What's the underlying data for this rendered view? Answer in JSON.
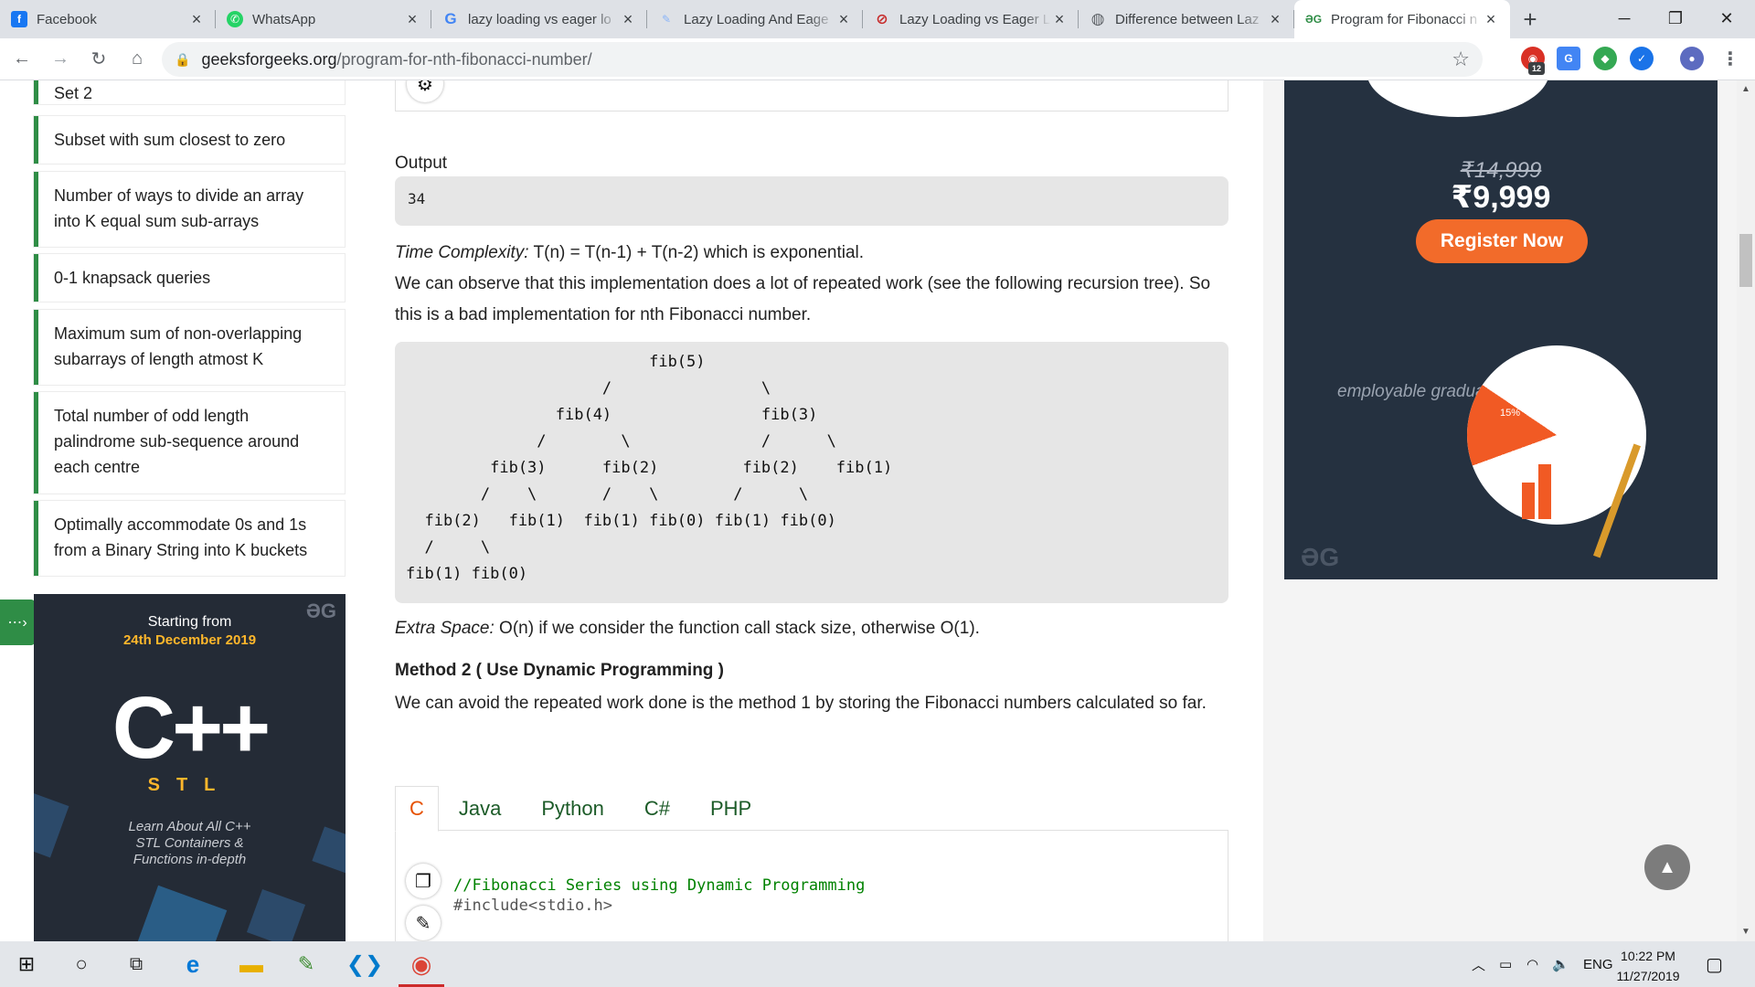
{
  "tabs": [
    {
      "title": "Facebook",
      "icon": "facebook-icon",
      "color": "#1877f2",
      "glyph": "f"
    },
    {
      "title": "WhatsApp",
      "icon": "whatsapp-icon",
      "color": "#25d366",
      "glyph": "✆"
    },
    {
      "title": "lazy loading vs eager lo",
      "icon": "google-icon",
      "color": "#4285f4",
      "glyph": "G"
    },
    {
      "title": "Lazy Loading And Eage",
      "icon": "page-icon",
      "color": "#9aa0a6",
      "glyph": "✎"
    },
    {
      "title": "Lazy Loading vs Eager L",
      "icon": "site-icon",
      "color": "#c62828",
      "glyph": "⊘"
    },
    {
      "title": "Difference between Laz",
      "icon": "globe-icon",
      "color": "#5f6368",
      "glyph": "◍"
    },
    {
      "title": "Program for Fibonacci n",
      "icon": "gfg-icon",
      "color": "#2f8d46",
      "glyph": "ƏG"
    }
  ],
  "toolbar": {
    "url_host": "geeksforgeeks.org",
    "url_path": "/program-for-nth-fibonacci-number/",
    "ext_badge": "12"
  },
  "sidebar": {
    "items": [
      "Set 2",
      "Subset with sum closest to zero",
      "Number of ways to divide an array into K equal sum sub-arrays",
      "0-1 knapsack queries",
      "Maximum sum of non-overlapping subarrays of length atmost K",
      "Total number of odd length palindrome sub-sequence around each centre",
      "Optimally accommodate 0s and 1s from a Binary String into K buckets"
    ],
    "ad": {
      "starting": "Starting from",
      "date": "24th December 2019",
      "logo": "C++",
      "stl": "STL",
      "learn": "Learn About All C++ STL Containers & Functions in-depth",
      "brand": "ƏG"
    }
  },
  "article": {
    "output_heading": "Output",
    "output_value": "34",
    "time_label": "Time Complexity:",
    "time_text": " T(n) = T(n-1) + T(n-2) which is exponential.",
    "observe_text": "We can observe that this implementation does a lot of repeated work (see the following recursion tree). So this is a bad implementation for nth Fibonacci number.",
    "tree": "                          fib(5)\n                     /                \\\n                fib(4)                fib(3)\n              /        \\              /      \\\n         fib(3)      fib(2)         fib(2)    fib(1)\n        /    \\       /    \\        /      \\\n  fib(2)   fib(1)  fib(1) fib(0) fib(1) fib(0)\n  /     \\\nfib(1) fib(0)",
    "space_label": "Extra Space:",
    "space_text": " O(n) if we consider the function call stack size, otherwise O(1).",
    "method_heading": "Method 2 ( Use Dynamic Programming )",
    "method_text": "We can avoid the repeated work done is the method 1 by storing the Fibonacci numbers calculated so far.",
    "lang_tabs": [
      "C",
      "Java",
      "Python",
      "C#",
      "PHP"
    ],
    "code_comment": "//Fibonacci Series using Dynamic Programming",
    "code_include": "#include<stdio.h>"
  },
  "right_ad": {
    "old_price": "₹14,999",
    "new_price": "₹9,999",
    "cta": "Register Now",
    "employable": "employable graduates",
    "pct": "15%",
    "brand": "ƏG"
  },
  "taskbar": {
    "lang": "ENG",
    "time": "10:22 PM",
    "date": "11/27/2019"
  },
  "colors": {
    "gfg_green": "#2f8d46",
    "cta_orange": "#f26b2a",
    "tab_active_orange": "#e65100"
  }
}
